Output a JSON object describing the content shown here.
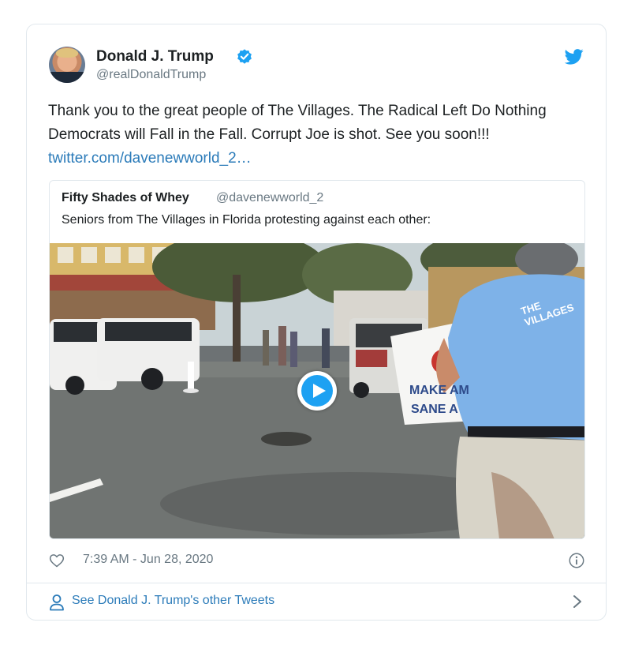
{
  "author": {
    "name": "Donald J. Trump",
    "handle": "@realDonaldTrump"
  },
  "tweet": {
    "text": "Thank you to the great people of The Villages. The Radical Left Do Nothing Democrats will Fall in the Fall. Corrupt Joe is shot. See you soon!!! ",
    "link": "twitter.com/davenewworld_2…"
  },
  "quoted": {
    "name": "Fifty Shades of Whey",
    "handle": "@davenewworld_2",
    "text": "Seniors from The Villages in Florida protesting against each other:",
    "sign_lines": [
      "MAKE AM",
      "SANE A"
    ],
    "shirt_text": "THE VILLAGES"
  },
  "meta": {
    "timestamp": "7:39 AM - Jun 28, 2020"
  },
  "footer": {
    "label": "See Donald J. Trump's other Tweets"
  },
  "icons": {
    "verified": "verified-badge-icon",
    "brand": "twitter-bird-icon",
    "like": "heart-icon",
    "info": "info-icon",
    "profile": "person-icon",
    "next": "chevron-right-icon",
    "play": "play-icon"
  },
  "colors": {
    "twitter_blue": "#1da1f2",
    "link": "#2b7bb9",
    "secondary_text": "#697882",
    "border": "#e1e8ed"
  }
}
